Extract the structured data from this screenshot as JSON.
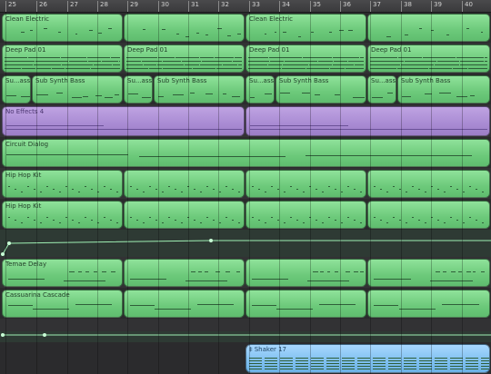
{
  "ruler": {
    "bars": [
      "25",
      "26",
      "27",
      "28",
      "29",
      "30",
      "31",
      "32",
      "33",
      "34",
      "35",
      "36",
      "37",
      "38",
      "39",
      "40"
    ]
  },
  "tracks": [
    {
      "regions": [
        {
          "name": "Clean Electric",
          "color": "green"
        },
        {
          "name": "",
          "color": "green"
        },
        {
          "name": "Clean Electric",
          "color": "green"
        },
        {
          "name": "",
          "color": "green"
        }
      ]
    },
    {
      "regions": [
        {
          "name": "Deep Pad 01",
          "color": "green"
        },
        {
          "name": "Deep Pad 01",
          "color": "green"
        },
        {
          "name": "Deep Pad 01",
          "color": "green"
        },
        {
          "name": "Deep Pad 01",
          "color": "green"
        }
      ]
    },
    {
      "regions": [
        {
          "name": "Su...ass",
          "color": "green"
        },
        {
          "name": "Sub Synth Bass",
          "color": "green"
        },
        {
          "name": "Su...ass",
          "color": "green"
        },
        {
          "name": "Sub Synth Bass",
          "color": "green"
        },
        {
          "name": "Su...ass",
          "color": "green"
        },
        {
          "name": "Sub Synth Bass",
          "color": "green"
        },
        {
          "name": "Su...ass",
          "color": "green"
        },
        {
          "name": "Sub Synth Bass",
          "color": "green"
        }
      ]
    },
    {
      "regions": [
        {
          "name": "No Effects 4",
          "color": "purple"
        },
        {
          "name": "",
          "color": "purple"
        }
      ]
    },
    {
      "regions": [
        {
          "name": "Circuit Dialog",
          "color": "green"
        }
      ]
    },
    {
      "regions": [
        {
          "name": "Hip Hop Kit",
          "color": "green"
        },
        {
          "name": "",
          "color": "green"
        },
        {
          "name": "",
          "color": "green"
        },
        {
          "name": "",
          "color": "green"
        }
      ]
    },
    {
      "regions": [
        {
          "name": "Hip Hop Kit",
          "color": "green"
        },
        {
          "name": "",
          "color": "green"
        },
        {
          "name": "",
          "color": "green"
        },
        {
          "name": "",
          "color": "green"
        }
      ]
    },
    {
      "regions": []
    },
    {
      "regions": [
        {
          "name": "Temae Delay",
          "color": "green"
        },
        {
          "name": "",
          "color": "green"
        },
        {
          "name": "",
          "color": "green"
        },
        {
          "name": "",
          "color": "green"
        }
      ]
    },
    {
      "regions": [
        {
          "name": "Cassuarina Cascade",
          "color": "green"
        },
        {
          "name": "",
          "color": "green"
        },
        {
          "name": "",
          "color": "green"
        },
        {
          "name": "",
          "color": "green"
        }
      ]
    },
    {
      "regions": []
    },
    {
      "regions": []
    },
    {
      "regions": [
        {
          "name": "Shaker 17",
          "color": "blue"
        }
      ]
    }
  ],
  "colors": {
    "green_region": "#7dd689",
    "purple_region": "#a98bd3",
    "blue_region": "#7fc0f0",
    "automation_line": "#9ff0b4"
  }
}
